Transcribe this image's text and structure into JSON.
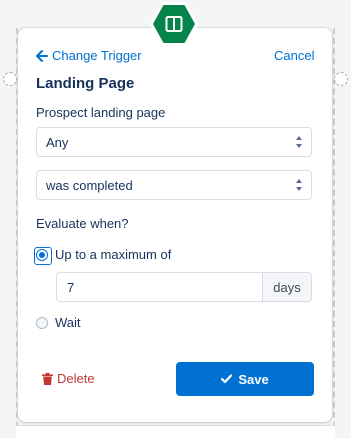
{
  "nav": {
    "back_label": "Change Trigger",
    "cancel_label": "Cancel"
  },
  "card": {
    "title": "Landing Page",
    "field_label": "Prospect landing page",
    "landing_page_select": {
      "value": "Any"
    },
    "status_select": {
      "value": "was completed"
    },
    "evaluate_label": "Evaluate when?",
    "options": [
      {
        "label": "Up to a maximum of",
        "checked": true
      },
      {
        "label": "Wait",
        "checked": false
      }
    ],
    "max_value": "7",
    "max_unit": "days"
  },
  "actions": {
    "delete_label": "Delete",
    "save_label": "Save"
  },
  "colors": {
    "accent": "#0070d2",
    "icon_bg": "#04844b",
    "danger": "#c23934",
    "text": "#16325c"
  },
  "icons": {
    "trigger": "split-columns-icon",
    "back": "arrow-left-icon",
    "select": "chevron-updown-icon",
    "delete": "trash-icon",
    "save": "check-icon"
  }
}
